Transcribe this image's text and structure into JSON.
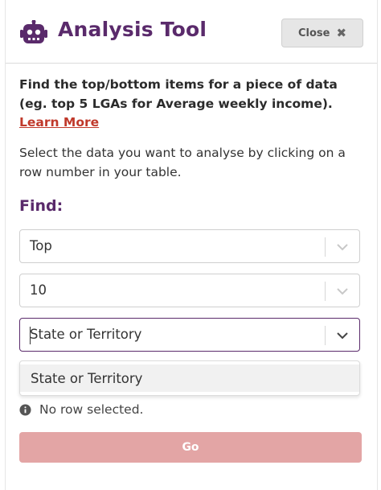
{
  "header": {
    "title": "Analysis Tool",
    "close_label": "Close"
  },
  "description": "Find the top/bottom items for a piece of data (eg. top 5 LGAs for Average weekly income).",
  "learn_more": "Learn More",
  "instructions": "Select the data you want to analyse by clicking on a row number in your table.",
  "find_label": "Find:",
  "selects": {
    "direction": {
      "value": "Top"
    },
    "count": {
      "value": "10"
    },
    "category": {
      "value": "State or Territory"
    }
  },
  "dropdown": {
    "options": [
      "State or Territory"
    ]
  },
  "status": "No row selected.",
  "go_label": "Go",
  "colors": {
    "brand": "#5a2a6b",
    "link": "#c0392b",
    "go_disabled": "#e3a5a5"
  }
}
